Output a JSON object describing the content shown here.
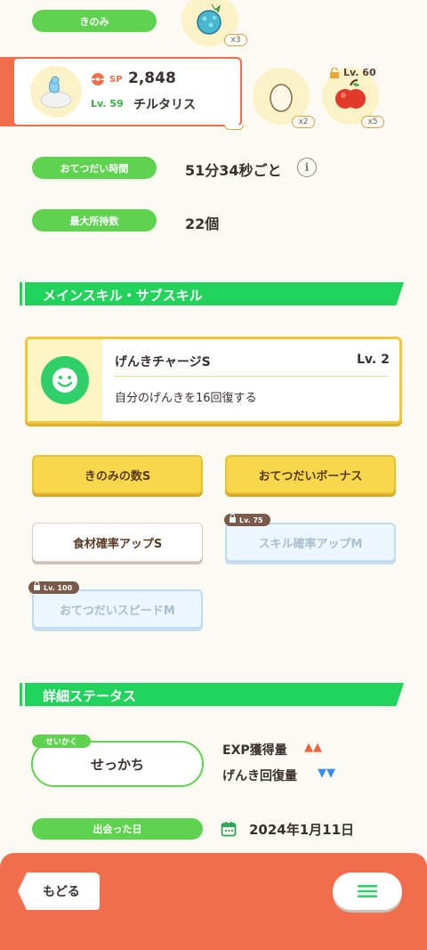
{
  "top": {
    "berry_label": "きのみ",
    "berry_count": "x3"
  },
  "pokemon": {
    "sp_label": "SP",
    "sp_value": "2,848",
    "level": "Lv. 59",
    "name": "チルタリス"
  },
  "ingredients": [
    {
      "icon": "egg-icon",
      "count": "x2"
    },
    {
      "icon": "apple-icon",
      "count": "x5",
      "lock_level": "Lv. 60"
    }
  ],
  "help_time": {
    "label": "おてつだい時間",
    "value": "51分34秒ごと",
    "info": "i"
  },
  "max_carry": {
    "label": "最大所持数",
    "value": "22個"
  },
  "skills_section": {
    "title": "メインスキル・サブスキル"
  },
  "main_skill": {
    "name": "げんきチャージS",
    "level": "Lv. 2",
    "description": "自分のげんきを16回復する"
  },
  "sub_skills": [
    {
      "label": "きのみの数S",
      "style": "yellow"
    },
    {
      "label": "おてつだいボーナス",
      "style": "yellow"
    },
    {
      "label": "食材確率アップS",
      "style": "white"
    },
    {
      "label": "スキル確率アップM",
      "style": "locked",
      "lock_level": "Lv. 75"
    },
    {
      "label": "おてつだいスピードM",
      "style": "locked",
      "lock_level": "Lv. 100"
    }
  ],
  "details_section": {
    "title": "詳細ステータス"
  },
  "nature": {
    "tag": "せいかく",
    "value": "せっかち",
    "up_stat": "EXP獲得量",
    "up_arrows": "▲▲",
    "down_stat": "げんき回復量",
    "down_arrows": "▼▼",
    "up_color": "#f0623a",
    "down_color": "#3a8ee8"
  },
  "met_date": {
    "label": "出会った日",
    "value": "2024年1月11日"
  },
  "footer": {
    "back_label": "もどる"
  },
  "colors": {
    "accent_green": "#22d35b",
    "footer_orange": "#f26d4c"
  }
}
